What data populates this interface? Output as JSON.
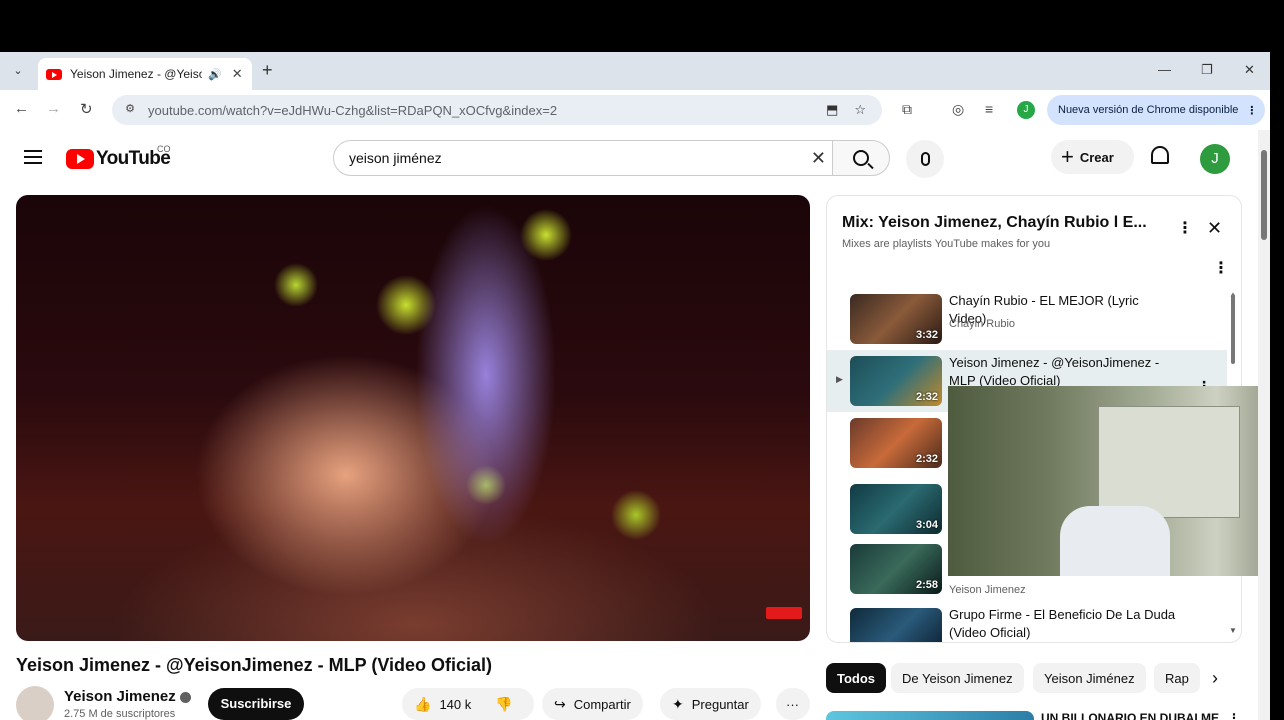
{
  "browser": {
    "tab_title": "Yeison Jimenez - @YeisonJi",
    "new_tab": "+",
    "url": "youtube.com/watch?v=eJdHWu-Czhg&list=RDaPQN_xOCfvg&index=2",
    "profile_initial": "J",
    "update_label": "Nueva versión de Chrome disponible"
  },
  "masthead": {
    "logo_text": "YouTube",
    "country_code": "CO",
    "search_value": "yeison jiménez",
    "create_label": "Crear",
    "avatar_initial": "J"
  },
  "video": {
    "title": "Yeison Jimenez - @YeisonJimenez - MLP (Video Oficial)",
    "channel": "Yeison Jimenez",
    "subscribers": "2.75 M de suscriptores",
    "subscribe_label": "Suscribirse",
    "likes": "140 k",
    "share_label": "Compartir",
    "ask_label": "Preguntar"
  },
  "playlist": {
    "title": "Mix: Yeison Jimenez, Chayín Rubio l E...",
    "subtitle": "Mixes are playlists YouTube makes for you",
    "items": [
      {
        "title": "Chayín Rubio - EL MEJOR (Lyric Video)",
        "channel": "Chayin Rubio",
        "duration": "3:32",
        "active": false
      },
      {
        "title": "Yeison Jimenez - @YeisonJimenez - MLP (Video Oficial)",
        "channel": "",
        "duration": "2:32",
        "active": true
      },
      {
        "title": "",
        "channel": "",
        "duration": "2:32",
        "active": false
      },
      {
        "title": "",
        "channel": "",
        "duration": "3:04",
        "active": false
      },
      {
        "title": "",
        "channel": "Yeison Jimenez",
        "duration": "2:58",
        "active": false
      },
      {
        "title": "Grupo Firme - El Beneficio De La Duda (Video Oficial)",
        "channel": "",
        "duration": "",
        "active": false
      }
    ]
  },
  "chips": [
    "Todos",
    "De Yeison Jimenez",
    "Yeison Jiménez",
    "Rap"
  ],
  "recommendation": {
    "title": "UN BILLONARIO EN DUBAI ME"
  },
  "colors": {
    "youtube_red": "#ff0000",
    "subscribe_bg": "#0f0f0f",
    "chrome_update_bg": "#d3e3fd",
    "active_row": "#e6eef0"
  }
}
